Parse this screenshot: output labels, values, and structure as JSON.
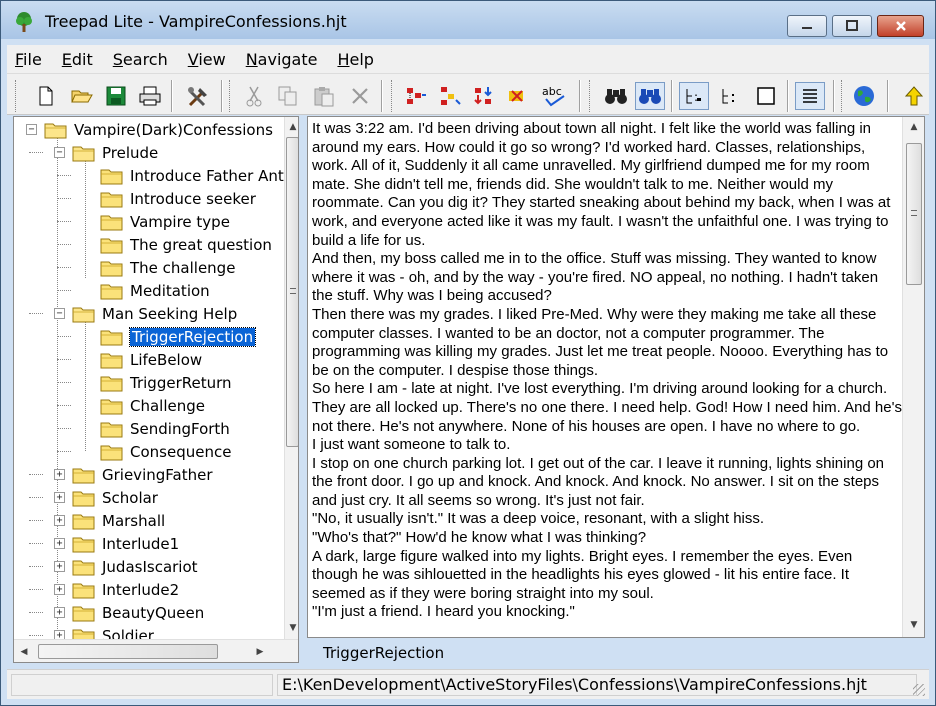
{
  "window": {
    "title": "Treepad Lite - VampireConfessions.hjt"
  },
  "menu": {
    "items": [
      {
        "label": "File",
        "key": "F",
        "rest": "ile"
      },
      {
        "label": "Edit",
        "key": "E",
        "rest": "dit"
      },
      {
        "label": "Search",
        "key": "S",
        "rest": "earch"
      },
      {
        "label": "View",
        "key": "V",
        "rest": "iew"
      },
      {
        "label": "Navigate",
        "key": "N",
        "rest": "avigate"
      },
      {
        "label": "Help",
        "key": "H",
        "rest": "elp"
      }
    ]
  },
  "toolbar": {
    "buttons": [
      {
        "icon": "new-file-icon"
      },
      {
        "icon": "open-folder-icon"
      },
      {
        "icon": "save-icon"
      },
      {
        "icon": "print-icon"
      },
      {
        "icon": "tools-icon"
      },
      {
        "icon": "cut-icon"
      },
      {
        "icon": "copy-icon"
      },
      {
        "icon": "paste-icon"
      },
      {
        "icon": "delete-icon"
      },
      {
        "icon": "insert-node-icon"
      },
      {
        "icon": "add-child-icon"
      },
      {
        "icon": "move-node-icon"
      },
      {
        "icon": "delete-node-icon"
      },
      {
        "icon": "spellcheck-icon"
      },
      {
        "icon": "find-icon"
      },
      {
        "icon": "find-next-icon"
      },
      {
        "icon": "tree-view-icon"
      },
      {
        "icon": "tree-collapse-icon"
      },
      {
        "icon": "blank-page-icon"
      },
      {
        "icon": "word-wrap-icon"
      },
      {
        "icon": "globe-icon"
      },
      {
        "icon": "up-arrow-icon"
      }
    ]
  },
  "tree": {
    "root": "Vampire(Dark)Confessions",
    "nodes": [
      {
        "label": "Vampire(Dark)Confessions",
        "level": 0,
        "expander": "minus"
      },
      {
        "label": "Prelude",
        "level": 1,
        "expander": "minus"
      },
      {
        "label": "Introduce Father Ant",
        "level": 2,
        "expander": ""
      },
      {
        "label": "Introduce seeker",
        "level": 2,
        "expander": ""
      },
      {
        "label": "Vampire type",
        "level": 2,
        "expander": ""
      },
      {
        "label": "The great question",
        "level": 2,
        "expander": ""
      },
      {
        "label": "The challenge",
        "level": 2,
        "expander": ""
      },
      {
        "label": "Meditation",
        "level": 2,
        "expander": ""
      },
      {
        "label": "Man Seeking Help",
        "level": 1,
        "expander": "minus"
      },
      {
        "label": "TriggerRejection",
        "level": 2,
        "expander": "",
        "selected": true
      },
      {
        "label": "LifeBelow",
        "level": 2,
        "expander": ""
      },
      {
        "label": "TriggerReturn",
        "level": 2,
        "expander": ""
      },
      {
        "label": "Challenge",
        "level": 2,
        "expander": ""
      },
      {
        "label": "SendingForth",
        "level": 2,
        "expander": ""
      },
      {
        "label": "Consequence",
        "level": 2,
        "expander": ""
      },
      {
        "label": "GrievingFather",
        "level": 1,
        "expander": "plus"
      },
      {
        "label": "Scholar",
        "level": 1,
        "expander": "plus"
      },
      {
        "label": "Marshall",
        "level": 1,
        "expander": "plus"
      },
      {
        "label": "Interlude1",
        "level": 1,
        "expander": "plus"
      },
      {
        "label": "JudasIscariot",
        "level": 1,
        "expander": "plus"
      },
      {
        "label": "Interlude2",
        "level": 1,
        "expander": "plus"
      },
      {
        "label": "BeautyQueen",
        "level": 1,
        "expander": "plus"
      },
      {
        "label": "Soldier",
        "level": 1,
        "expander": "plus"
      }
    ]
  },
  "document": {
    "paragraphs": [
      "It was 3:22 am. I'd been driving about town all night. I felt like the world was falling in around my ears. How could it go so wrong? I'd worked hard. Classes, relationships, work. All of it, Suddenly it all came unravelled. My girlfriend dumped me for my room mate. She didn't tell me, friends did. She wouldn't talk to me. Neither would my roommate. Can you dig it? They started sneaking about behind my back, when I was at work, and everyone acted like it was my fault. I wasn't the unfaithful one. I was trying to build a life for us.",
      "And then, my boss called me in to the office. Stuff was missing. They wanted to know where it was - oh, and by the way - you're fired. NO appeal, no nothing. I hadn't taken the stuff. Why was I being accused?",
      "Then there was my grades. I liked Pre-Med. Why were they making me take all these computer classes. I wanted to be an doctor, not a computer programmer. The programming was killing my grades. Just let me treat people. Noooo. Everything has to be on the computer. I despise those things.",
      "So here I am - late at night. I've lost everything. I'm driving around looking for a church. They are all locked up. There's no one there. I need help. God! How I need him. And he's not there. He's not anywhere. None of his houses are open. I have no where to go.",
      "I just want someone to talk to.",
      "I stop on one church parking lot. I get out of the car. I leave it running, lights shining on the front door. I go up and knock. And knock. And knock. No answer. I sit on the steps and just cry. It all seems so wrong. It's just not fair.",
      "\"No, it usually isn't.\"  It was a deep voice, resonant, with a slight hiss.",
      "\"Who's that?\" How'd he know what I was thinking?",
      "A dark, large figure walked into my lights. Bright eyes. I remember the eyes. Even though he was sihlouetted in the headlights his eyes glowed - lit his entire face. It seemed as if they were boring straight into my soul.",
      "\"I'm just a friend. I heard you knocking.\""
    ]
  },
  "node_title": "TriggerRejection",
  "status": {
    "path": "E:\\KenDevelopment\\ActiveStoryFiles\\Confessions\\VampireConfessions.hjt"
  }
}
